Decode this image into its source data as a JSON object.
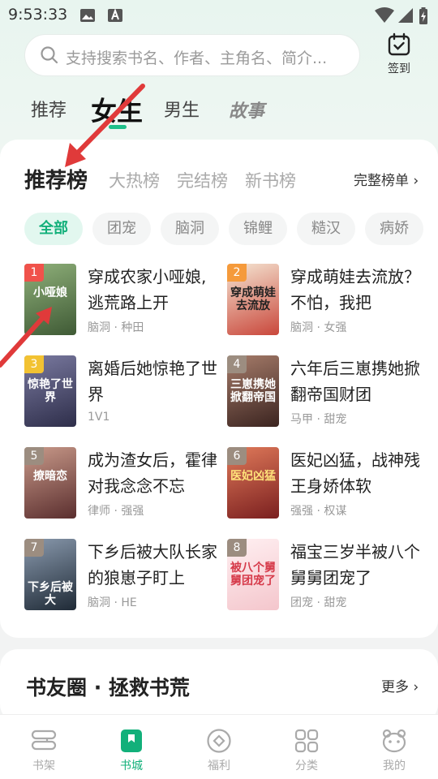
{
  "status": {
    "time": "9:53:33"
  },
  "search": {
    "placeholder": "支持搜索书名、作者、主角名、简介..."
  },
  "checkin": {
    "label": "签到"
  },
  "top_tabs": [
    {
      "label": "推荐"
    },
    {
      "label": "女生"
    },
    {
      "label": "男生"
    },
    {
      "label": "故事"
    }
  ],
  "rank_tabs": [
    {
      "label": "推荐榜"
    },
    {
      "label": "大热榜"
    },
    {
      "label": "完结榜"
    },
    {
      "label": "新书榜"
    }
  ],
  "full_list_label": "完整榜单 ›",
  "chips": [
    "全部",
    "团宠",
    "脑洞",
    "锦鲤",
    "糙汉",
    "病娇"
  ],
  "books": [
    {
      "rank": "1",
      "title": "穿成农家小哑娘,逃荒路上开",
      "tags": "脑洞 · 种田",
      "cover_text": "小哑娘",
      "cover_color": "#5a7a4c",
      "badge_color": "#f0524b"
    },
    {
      "rank": "2",
      "title": "穿成萌娃去流放？不怕，我把",
      "tags": "脑洞 · 女强",
      "cover_text": "穿成萌娃去流放",
      "cover_color": "#c9473b",
      "badge_color": "#f59a3b"
    },
    {
      "rank": "3",
      "title": "离婚后她惊艳了世界",
      "tags": "1V1",
      "cover_text": "惊艳了世界",
      "cover_color": "#3e3e5e",
      "badge_color": "#f2c232"
    },
    {
      "rank": "4",
      "title": "六年后三崽携她掀翻帝国财团",
      "tags": "马甲 · 甜宠",
      "cover_text": "三崽携她掀翻帝国",
      "cover_color": "#5c3a32",
      "badge_color": "#9c8d80"
    },
    {
      "rank": "5",
      "title": "成为渣女后，霍律对我念念不忘",
      "tags": "律师 · 强强",
      "cover_text": "撩暗恋",
      "cover_color": "#6a3b3b",
      "badge_color": "#9c8d80"
    },
    {
      "rank": "6",
      "title": "医妃凶猛，战神残王身娇体软",
      "tags": "强强 · 权谋",
      "cover_text": "医妃凶猛",
      "cover_color": "#8a2b2b",
      "badge_color": "#9c8d80"
    },
    {
      "rank": "7",
      "title": "下乡后被大队长家的狼崽子盯上",
      "tags": "脑洞 · HE",
      "cover_text": "下乡后被大",
      "cover_color": "#2f3b4a",
      "badge_color": "#9c8d80"
    },
    {
      "rank": "8",
      "title": "福宝三岁半被八个舅舅团宠了",
      "tags": "团宠 · 甜宠",
      "cover_text": "被八个舅舅团宠了",
      "cover_color": "#f4d6d9",
      "badge_color": "#9c8d80"
    }
  ],
  "circle": {
    "title": "书友圈 · 拯救书荒",
    "more": "更多 ›"
  },
  "bottom_nav": [
    {
      "label": "书架",
      "icon": "bookshelf-icon"
    },
    {
      "label": "书城",
      "icon": "bookstore-icon"
    },
    {
      "label": "福利",
      "icon": "welfare-icon"
    },
    {
      "label": "分类",
      "icon": "category-icon"
    },
    {
      "label": "我的",
      "icon": "profile-icon"
    }
  ],
  "colors": {
    "accent": "#12b07a",
    "annotation": "#e03a3a"
  }
}
